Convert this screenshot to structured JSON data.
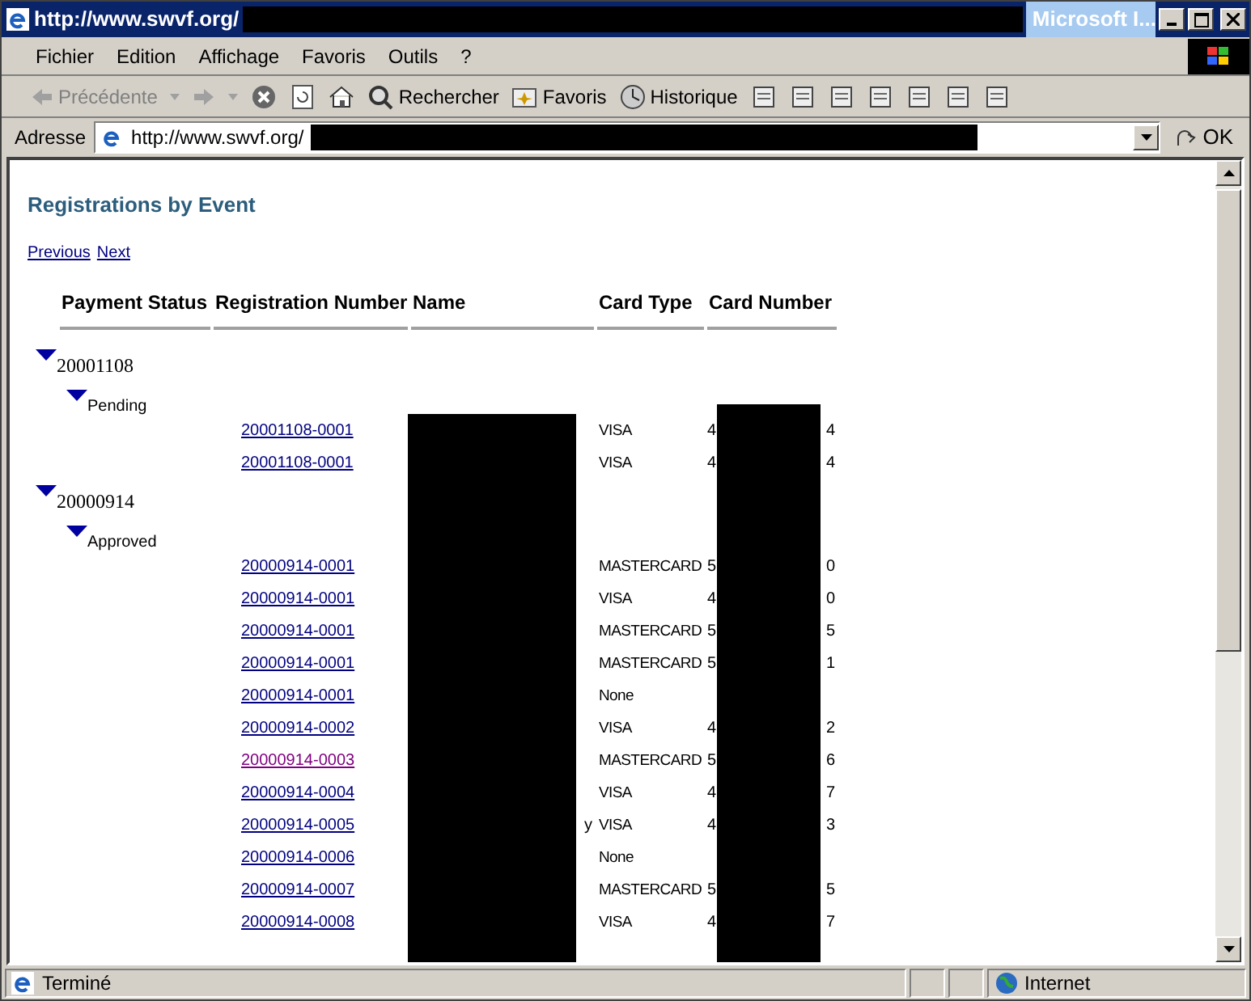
{
  "window": {
    "title": "http://www.swvf.org/",
    "app_name": "Microsoft I..."
  },
  "menu": [
    "Fichier",
    "Edition",
    "Affichage",
    "Favoris",
    "Outils",
    "?"
  ],
  "toolbar": {
    "back": "Précédente",
    "search": "Rechercher",
    "favorites": "Favoris",
    "history": "Historique"
  },
  "address": {
    "label": "Adresse",
    "value": "http://www.swvf.org/",
    "go": "OK"
  },
  "page": {
    "title": "Registrations by Event",
    "links": [
      "Previous",
      "Next"
    ],
    "columns": [
      "Payment Status",
      "Registration Number",
      "Name",
      "Card Type",
      "Card Number"
    ],
    "groups": [
      {
        "label": "20001108",
        "expanded": true,
        "children": [
          {
            "label": "Pending",
            "expanded": true,
            "rows": [
              {
                "reg": "20001108-0001",
                "visited": false,
                "name": "",
                "card_type": "VISA",
                "card_start": "4",
                "card_end": "4"
              },
              {
                "reg": "20001108-0001",
                "visited": false,
                "name": "",
                "card_type": "VISA",
                "card_start": "4",
                "card_end": "4"
              }
            ]
          }
        ]
      },
      {
        "label": "20000914",
        "expanded": true,
        "children": [
          {
            "label": "Approved",
            "expanded": true,
            "rows": [
              {
                "reg": "20000914-0001",
                "visited": false,
                "name": "",
                "card_type": "MASTERCARD",
                "card_start": "5",
                "card_end": "0"
              },
              {
                "reg": "20000914-0001",
                "visited": false,
                "name": "",
                "card_type": "VISA",
                "card_start": "4",
                "card_end": "0"
              },
              {
                "reg": "20000914-0001",
                "visited": false,
                "name": "",
                "card_type": "MASTERCARD",
                "card_start": "5",
                "card_end": "5"
              },
              {
                "reg": "20000914-0001",
                "visited": false,
                "name": "",
                "card_type": "MASTERCARD",
                "card_start": "5",
                "card_end": "1"
              },
              {
                "reg": "20000914-0001",
                "visited": false,
                "name": "",
                "card_type": "None",
                "card_start": "",
                "card_end": ""
              },
              {
                "reg": "20000914-0002",
                "visited": false,
                "name": "",
                "card_type": "VISA",
                "card_start": "4",
                "card_end": "2"
              },
              {
                "reg": "20000914-0003",
                "visited": true,
                "name": "",
                "card_type": "MASTERCARD",
                "card_start": "5",
                "card_end": "6"
              },
              {
                "reg": "20000914-0004",
                "visited": false,
                "name": "",
                "card_type": "VISA",
                "card_start": "4",
                "card_end": "7"
              },
              {
                "reg": "20000914-0005",
                "visited": false,
                "name": "y",
                "card_type": "VISA",
                "card_start": "4",
                "card_end": "3"
              },
              {
                "reg": "20000914-0006",
                "visited": false,
                "name": "",
                "card_type": "None",
                "card_start": "",
                "card_end": ""
              },
              {
                "reg": "20000914-0007",
                "visited": false,
                "name": "",
                "card_type": "MASTERCARD",
                "card_start": "5",
                "card_end": "5"
              },
              {
                "reg": "20000914-0008",
                "visited": false,
                "name": "",
                "card_type": "VISA",
                "card_start": "4",
                "card_end": "7"
              }
            ]
          }
        ]
      }
    ]
  },
  "status_bar": {
    "text": "Terminé",
    "zone": "Internet"
  }
}
